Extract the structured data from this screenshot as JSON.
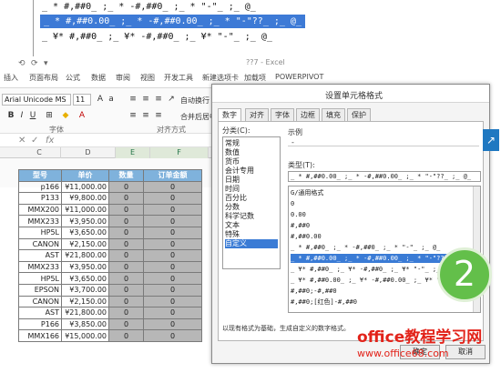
{
  "zoom_lines": [
    "_ * #,##0_ ;_ * -#,##0_ ;_ * \"-\"_ ;_ @_",
    "_ * #,##0.00_ ;_ * -#,##0.00_ ;_ * \"-\"??_ ;_ @_",
    "_ ¥* #,##0_ ;_ ¥* -#,##0_ ;_ ¥* \"-\"_ ;_ @_"
  ],
  "excel": {
    "title": "??7 - Excel",
    "ribbon_tabs": [
      "插入",
      "页面布局",
      "公式",
      "数据",
      "审阅",
      "视图",
      "开发工具",
      "新建选项卡",
      "加载项",
      "POWERPIVOT"
    ],
    "font_name": "Arial Unicode MS",
    "font_size": "11",
    "group_labels": {
      "font": "字体",
      "align": "对齐方式"
    },
    "wrap_label": "自动换行",
    "merge_label": "合并后居中",
    "formula_icon": "fx",
    "columns": [
      "C",
      "D",
      "E",
      "F"
    ],
    "table_headers": [
      "型号",
      "单价",
      "数量",
      "订单金额"
    ],
    "rows": [
      [
        "p166",
        "¥11,000.00",
        "0",
        "0"
      ],
      [
        "P133",
        "¥9,800.00",
        "0",
        "0"
      ],
      [
        "MMX200",
        "¥11,000.00",
        "0",
        "0"
      ],
      [
        "MMX233",
        "¥3,950.00",
        "0",
        "0"
      ],
      [
        "HP5L",
        "¥3,650.00",
        "0",
        "0"
      ],
      [
        "CANON",
        "¥2,150.00",
        "0",
        "0"
      ],
      [
        "AST",
        "¥21,800.00",
        "0",
        "0"
      ],
      [
        "MMX233",
        "¥3,950.00",
        "0",
        "0"
      ],
      [
        "HP5L",
        "¥3,650.00",
        "0",
        "0"
      ],
      [
        "EPSON",
        "¥3,700.00",
        "0",
        "0"
      ],
      [
        "CANON",
        "¥2,150.00",
        "0",
        "0"
      ],
      [
        "AST",
        "¥21,800.00",
        "0",
        "0"
      ],
      [
        "P166",
        "¥3,850.00",
        "0",
        "0"
      ],
      [
        "MMX166",
        "¥15,000.00",
        "0",
        "0"
      ]
    ]
  },
  "dialog": {
    "title": "设置单元格格式",
    "tabs": [
      "数字",
      "对齐",
      "字体",
      "边框",
      "填充",
      "保护"
    ],
    "category_label": "分类(C):",
    "categories": [
      "常规",
      "数值",
      "货币",
      "会计专用",
      "日期",
      "时间",
      "百分比",
      "分数",
      "科学记数",
      "文本",
      "特殊",
      "自定义"
    ],
    "selected_category": "自定义",
    "sample_label": "示例",
    "sample_value": "-",
    "type_label": "类型(T):",
    "type_value": "_ * #,##0.00_ ;_ * -#,##0.00_ ;_ * \"-\"??_ ;_ @_",
    "formats": [
      "G/通用格式",
      "0",
      "0.00",
      "#,##0",
      "#,##0.00",
      "_ * #,##0_ ;_ * -#,##0_ ;_ * \"-\"_ ;_ @_",
      "_ * #,##0.00_ ;_ * -#,##0.00_ ;_ * \"-\"??_ ;_ @_",
      "_ ¥* #,##0_ ;_ ¥* -#,##0_ ;_ ¥* \"-\"_ ;_ @_",
      "_ ¥* #,##0.00_ ;_ ¥* -#,##0.00_ ;_ ¥* \"-\"??_ ;_ @_",
      "#,##0;-#,##0",
      "#,##0;[红色]-#,##0"
    ],
    "selected_format_index": 6,
    "description": "以现有格式为基础，生成自定义的数字格式。",
    "buttons": {
      "ok": "确定",
      "cancel": "取消"
    }
  },
  "badge": "2",
  "watermark": {
    "title": "office教程学习网",
    "url": "www.office68.com"
  },
  "colors": {
    "accent": "#3a7bd5",
    "header_fill": "#7fb2dc",
    "badge": "#63bf4a",
    "watermark": "#e2231a"
  }
}
